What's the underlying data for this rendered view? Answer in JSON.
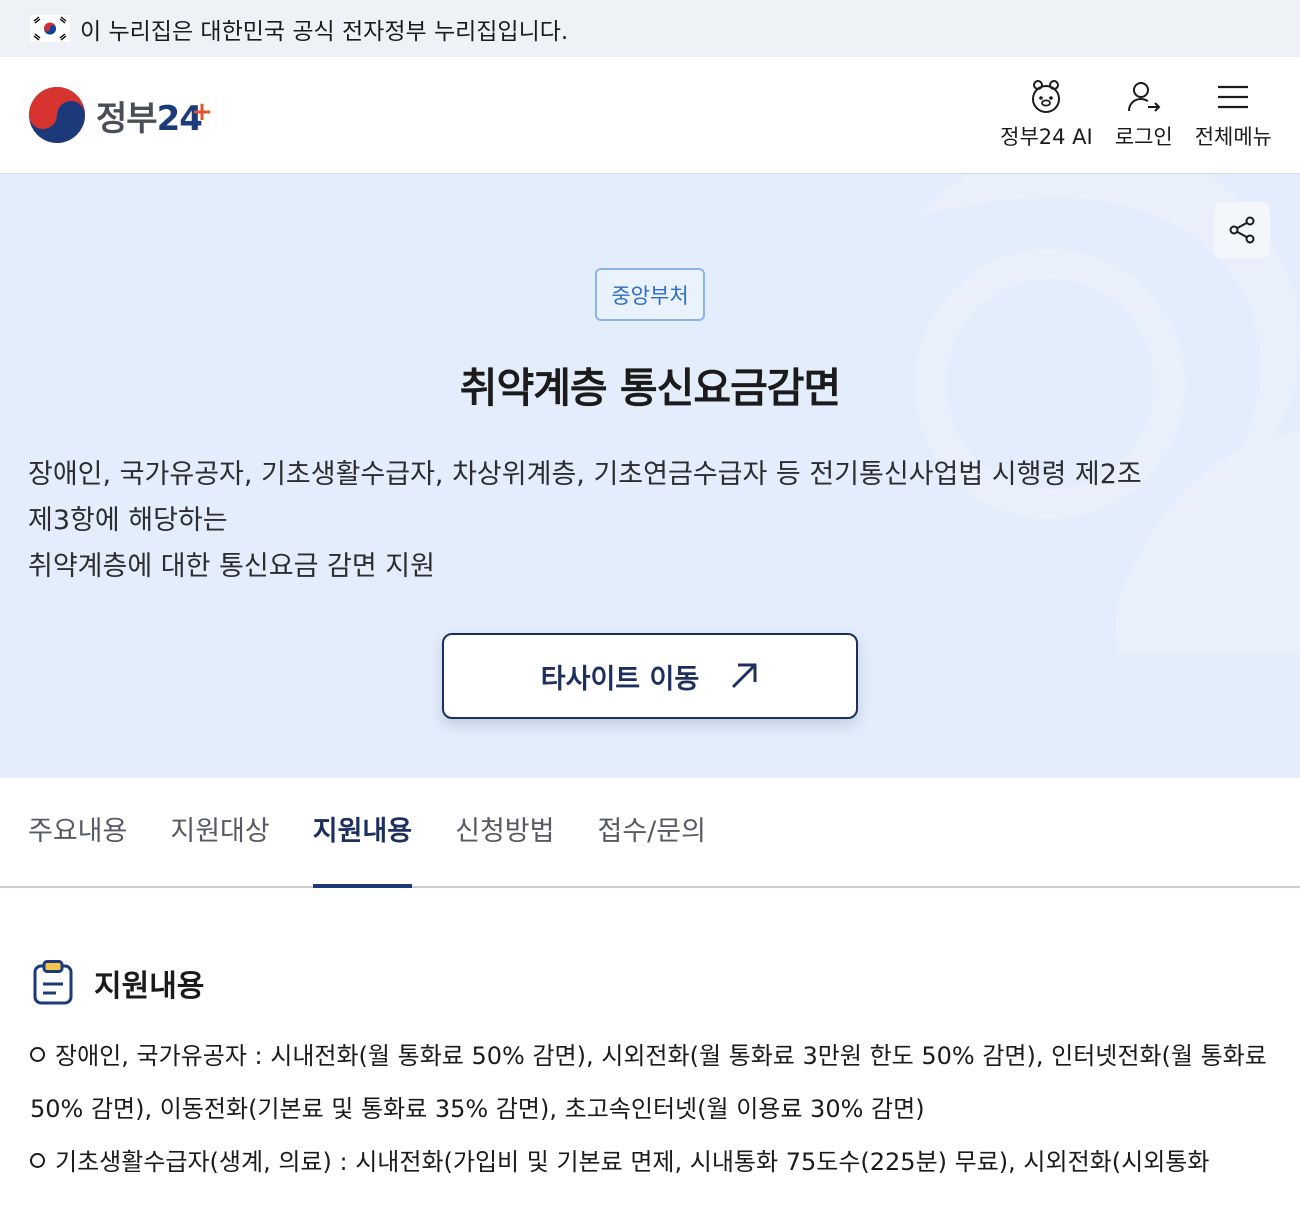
{
  "gov_banner": {
    "text": "이 누리집은 대한민국 공식 전자정부 누리집입니다.",
    "icon": "korea-flag-icon"
  },
  "header": {
    "logo_text": "정부",
    "logo_number": "24",
    "actions": [
      {
        "label": "정부24 AI",
        "icon": "ai-character-icon"
      },
      {
        "label": "로그인",
        "icon": "login-person-icon"
      },
      {
        "label": "전체메뉴",
        "icon": "hamburger-menu-icon"
      }
    ]
  },
  "hero": {
    "badge": "중앙부처",
    "title": "취약계층 통신요금감면",
    "description_lines": [
      "장애인, 국가유공자, 기초생활수급자, 차상위계층, 기초연금수급자 등 전기통신사업법 시행령 제2조",
      "제3항에 해당하는",
      "취약계층에 대한 통신요금 감면 지원"
    ],
    "button_label": "타사이트 이동",
    "button_icon": "arrow-up-right-icon",
    "share_icon": "share-icon"
  },
  "tabs": [
    {
      "label": "주요내용",
      "active": false
    },
    {
      "label": "지원대상",
      "active": false
    },
    {
      "label": "지원내용",
      "active": true
    },
    {
      "label": "신청방법",
      "active": false
    },
    {
      "label": "접수/문의",
      "active": false
    }
  ],
  "section": {
    "title": "지원내용",
    "icon": "clipboard-icon",
    "lines": [
      "장애인, 국가유공자 : 시내전화(월 통화료 50% 감면), 시외전화(월 통화료 3만원 한도 50% 감면), 인터넷전화(월 통화료",
      "50% 감면), 이동전화(기본료 및 통화료 35% 감면), 초고속인터넷(월 이용료 30% 감면)",
      "기초생활수급자(생계, 의료) : 시내전화(가입비 및 기본료 면제, 시내통화 75도수(225분) 무료), 시외전화(시외통화"
    ]
  },
  "colors": {
    "hero_bg": "#e4edfb",
    "navy": "#1c2f5e",
    "badge_blue": "#2f6dc0",
    "logo_red": "#e2522f"
  }
}
